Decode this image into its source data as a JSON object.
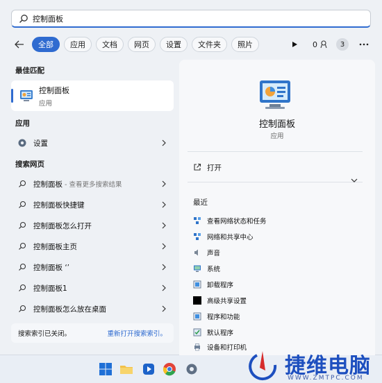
{
  "search": {
    "value": "控制面板"
  },
  "filters": {
    "chips": [
      "全部",
      "应用",
      "文档",
      "网页",
      "设置",
      "文件夹",
      "照片"
    ],
    "points": "0",
    "badge": "3"
  },
  "left": {
    "best_match_header": "最佳匹配",
    "best_match": {
      "title": "控制面板",
      "subtitle": "应用"
    },
    "apps_header": "应用",
    "apps": [
      {
        "label": "设置"
      }
    ],
    "web_header": "搜索网页",
    "web": [
      {
        "label": "控制面板",
        "suffix": " - 查看更多搜索结果"
      },
      {
        "label": "控制面板快捷键",
        "suffix": ""
      },
      {
        "label": "控制面板怎么打开",
        "suffix": ""
      },
      {
        "label": "控制面板主页",
        "suffix": ""
      },
      {
        "label": "控制面板 ‘’",
        "suffix": ""
      },
      {
        "label": "控制面板1",
        "suffix": ""
      },
      {
        "label": "控制面板怎么放在桌面",
        "suffix": ""
      }
    ],
    "footer": {
      "text": "搜索索引已关闭。",
      "link": "重新打开搜索索引。"
    }
  },
  "right": {
    "title": "控制面板",
    "subtitle": "应用",
    "open_label": "打开",
    "recent_header": "最近",
    "recent": [
      "查看网络状态和任务",
      "网络和共享中心",
      "声音",
      "系统",
      "卸载程序",
      "高级共享设置",
      "程序和功能",
      "默认程序",
      "设备和打印机"
    ]
  },
  "watermark": {
    "text": "捷维电脑",
    "sub": "WWW.ZMTPC.COM"
  },
  "colors": {
    "accent": "#2f6bd0",
    "panel": "#eef1f5",
    "pane": "#f7f8fa"
  }
}
